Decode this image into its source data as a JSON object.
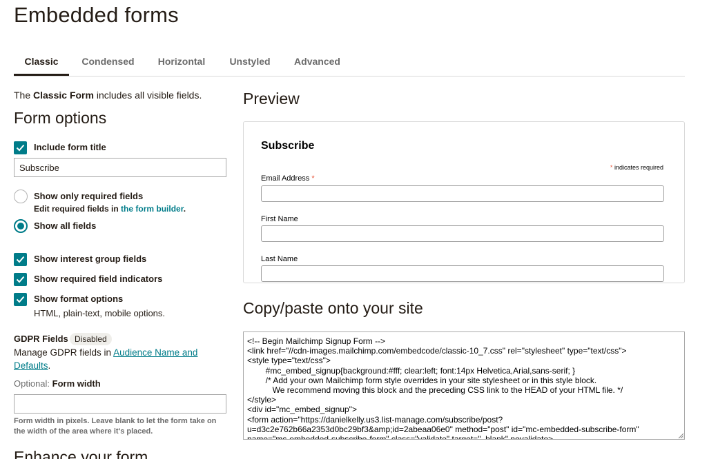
{
  "page": {
    "title": "Embedded forms"
  },
  "tabs": [
    {
      "label": "Classic",
      "active": true
    },
    {
      "label": "Condensed",
      "active": false
    },
    {
      "label": "Horizontal",
      "active": false
    },
    {
      "label": "Unstyled",
      "active": false
    },
    {
      "label": "Advanced",
      "active": false
    }
  ],
  "intro": {
    "prefix": "The ",
    "bold": "Classic Form",
    "suffix": " includes all visible fields."
  },
  "form_options": {
    "heading": "Form options",
    "include_title": {
      "label": "Include form title",
      "checked": true
    },
    "title_input_value": "Subscribe",
    "show_required_only": {
      "label": "Show only required fields",
      "selected": false
    },
    "edit_note": {
      "prefix": "Edit required fields in ",
      "link": "the form builder",
      "suffix": "."
    },
    "show_all": {
      "label": "Show all fields",
      "selected": true
    },
    "interest_groups": {
      "label": "Show interest group fields",
      "checked": true
    },
    "required_indicators": {
      "label": "Show required field indicators",
      "checked": true
    },
    "format_options": {
      "label": "Show format options",
      "checked": true,
      "note": "HTML, plain-text, mobile options."
    }
  },
  "gdpr": {
    "title": "GDPR Fields",
    "badge": "Disabled",
    "text_prefix": "Manage GDPR fields in ",
    "link": "Audience Name and Defaults",
    "text_suffix": "."
  },
  "form_width": {
    "optional_prefix": "Optional: ",
    "label": "Form width",
    "value": "",
    "help": "Form width in pixels. Leave blank to let the form take on the width of the area where it's placed."
  },
  "enhance": {
    "heading": "Enhance your form"
  },
  "preview": {
    "heading": "Preview",
    "form_title": "Subscribe",
    "required_note": "indicates required",
    "star": "*",
    "fields": [
      {
        "label": "Email Address",
        "required": true
      },
      {
        "label": "First Name",
        "required": false
      },
      {
        "label": "Last Name",
        "required": false
      }
    ]
  },
  "copy": {
    "heading": "Copy/paste onto your site",
    "code": "<!-- Begin Mailchimp Signup Form -->\n<link href=\"//cdn-images.mailchimp.com/embedcode/classic-10_7.css\" rel=\"stylesheet\" type=\"text/css\">\n<style type=\"text/css\">\n        #mc_embed_signup{background:#fff; clear:left; font:14px Helvetica,Arial,sans-serif; }\n        /* Add your own Mailchimp form style overrides in your site stylesheet or in this style block.\n           We recommend moving this block and the preceding CSS link to the HEAD of your HTML file. */\n</style>\n<div id=\"mc_embed_signup\">\n<form action=\"https://danielkelly.us3.list-manage.com/subscribe/post?\nu=d3c2e762b66a2353d0bc29bf3&amp;id=2abeaa06e0\" method=\"post\" id=\"mc-embedded-subscribe-form\"\nname=\"mc-embedded-subscribe-form\" class=\"validate\" target=\"_blank\" novalidate>"
  },
  "colors": {
    "accent": "#007c89",
    "required_star": "#e85c41",
    "text": "#241c15"
  }
}
